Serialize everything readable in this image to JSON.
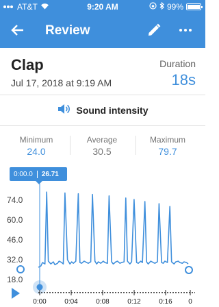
{
  "status_bar": {
    "carrier": "AT&T",
    "time": "9:20 AM",
    "battery": "99%"
  },
  "app_bar": {
    "title": "Review"
  },
  "recording": {
    "name": "Clap",
    "datetime": "Jul 17, 2018 at 9:19 AM",
    "duration_label": "Duration",
    "duration_value": "18s"
  },
  "sensor": {
    "label": "Sound intensity"
  },
  "stats": {
    "minimum_label": "Minimum",
    "minimum_value": "24.0",
    "average_label": "Average",
    "average_value": "30.5",
    "maximum_label": "Maximum",
    "maximum_value": "79.7"
  },
  "tooltip": {
    "time": "0:00.0",
    "value": "26.71"
  },
  "colors": {
    "accent": "#3f8fdc"
  },
  "icons": [
    "back-arrow-icon",
    "edit-pencil-icon",
    "more-dots-icon",
    "speaker-icon",
    "play-icon",
    "wifi-icon",
    "bluetooth-icon",
    "battery-icon"
  ],
  "chart_data": {
    "type": "line",
    "y_ticks": [
      "74.0",
      "60.0",
      "46.0",
      "32.0",
      "18.0"
    ],
    "x_ticks": [
      "0:00",
      "0:04",
      "0:08",
      "0:12",
      "0:16",
      "0"
    ],
    "ylim": [
      18,
      80
    ],
    "xlim": [
      0,
      18
    ],
    "series": [
      {
        "x": [
          0.0,
          0.3,
          0.5,
          0.8,
          1.0,
          1.2,
          1.5,
          1.8,
          2.0,
          2.3,
          2.5,
          2.8,
          3.0,
          3.2,
          3.5,
          3.8,
          4.0,
          4.2,
          4.5,
          4.8,
          5.0,
          5.2,
          5.5,
          5.8,
          6.0,
          6.3,
          6.5,
          6.8,
          7.0,
          7.2,
          7.5,
          7.8,
          8.0,
          8.3,
          8.5,
          8.8,
          9.0,
          9.3,
          9.5,
          9.8,
          10.0,
          10.3,
          10.5,
          10.7,
          11.0,
          11.2,
          11.5,
          11.8,
          12.0,
          12.3,
          12.5,
          12.8,
          13.0,
          13.2,
          13.5,
          13.8,
          14.0,
          14.3,
          14.5,
          14.8,
          15.0,
          15.2,
          15.5,
          15.8,
          16.0,
          16.3,
          16.5,
          16.8,
          17.0,
          17.3,
          17.5,
          17.8,
          18.0
        ],
        "y": [
          26.7,
          27.5,
          30.0,
          29.0,
          79.7,
          31.0,
          29.0,
          30.5,
          28.5,
          29.5,
          31.0,
          30.0,
          29.0,
          79.0,
          32.0,
          29.0,
          30.5,
          29.5,
          31.0,
          78.5,
          30.0,
          29.5,
          31.0,
          30.0,
          29.5,
          30.5,
          78.0,
          31.0,
          29.0,
          30.5,
          29.5,
          31.0,
          30.0,
          29.5,
          77.0,
          30.5,
          29.0,
          30.5,
          31.0,
          29.5,
          30.0,
          30.5,
          75.5,
          31.0,
          29.0,
          30.5,
          74.5,
          30.0,
          29.5,
          31.0,
          30.0,
          73.0,
          30.5,
          29.0,
          31.0,
          30.0,
          29.5,
          30.5,
          71.5,
          30.0,
          29.5,
          31.0,
          30.0,
          69.5,
          30.5,
          29.0,
          30.5,
          31.0,
          30.0,
          29.5,
          30.5,
          30.0,
          29.0
        ]
      }
    ]
  }
}
